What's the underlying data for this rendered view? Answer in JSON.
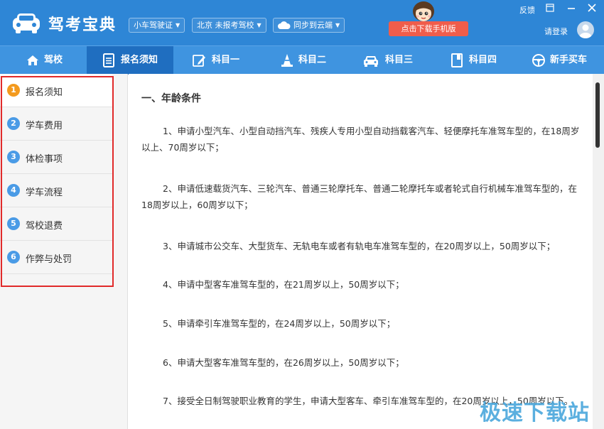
{
  "header": {
    "app_title": "驾考宝典",
    "license_type": "小车驾驶证",
    "location": "北京 未报考驾校",
    "sync": "同步到云端",
    "download": "点击下载手机版",
    "feedback": "反馈",
    "login": "请登录"
  },
  "nav": [
    {
      "label": "驾校",
      "icon": "house-icon"
    },
    {
      "label": "报名须知",
      "icon": "document-icon"
    },
    {
      "label": "科目一",
      "icon": "pencil-icon"
    },
    {
      "label": "科目二",
      "icon": "cone-icon"
    },
    {
      "label": "科目三",
      "icon": "car-icon"
    },
    {
      "label": "科目四",
      "icon": "book-icon"
    },
    {
      "label": "新手买车",
      "icon": "steering-wheel-icon"
    }
  ],
  "nav_active": "报名须知",
  "sidebar": {
    "items": [
      {
        "num": "1",
        "label": "报名须知"
      },
      {
        "num": "2",
        "label": "学车费用"
      },
      {
        "num": "3",
        "label": "体检事项"
      },
      {
        "num": "4",
        "label": "学车流程"
      },
      {
        "num": "5",
        "label": "驾校退费"
      },
      {
        "num": "6",
        "label": "作弊与处罚"
      }
    ],
    "active": "报名须知"
  },
  "content": {
    "heading": "一、年龄条件",
    "paragraphs": [
      "1、申请小型汽车、小型自动挡汽车、残疾人专用小型自动挡载客汽车、轻便摩托车准驾车型的，在18周岁以上、70周岁以下；",
      "2、申请低速载货汽车、三轮汽车、普通三轮摩托车、普通二轮摩托车或者轮式自行机械车准驾车型的，在18周岁以上，60周岁以下；",
      "3、申请城市公交车、大型货车、无轨电车或者有轨电车准驾车型的，在20周岁以上，50周岁以下；",
      "4、申请中型客车准驾车型的，在21周岁以上，50周岁以下；",
      "5、申请牵引车准驾车型的，在24周岁以上，50周岁以下；",
      "6、申请大型客车准驾车型的，在26周岁以上，50周岁以下；",
      "7、接受全日制驾驶职业教育的学生，申请大型客车、牵引车准驾车型的，在20周岁以上，50周岁以下。"
    ]
  },
  "watermark": "极速下载站",
  "colors": {
    "header_bg": "#2e86d6",
    "nav_bg": "#3f94e0",
    "nav_active_bg": "#1f6ec0",
    "badge_blue": "#4a9be6",
    "badge_orange": "#f39a1e",
    "download_btn": "#f05d4b",
    "highlight_box": "#e12a2a"
  }
}
